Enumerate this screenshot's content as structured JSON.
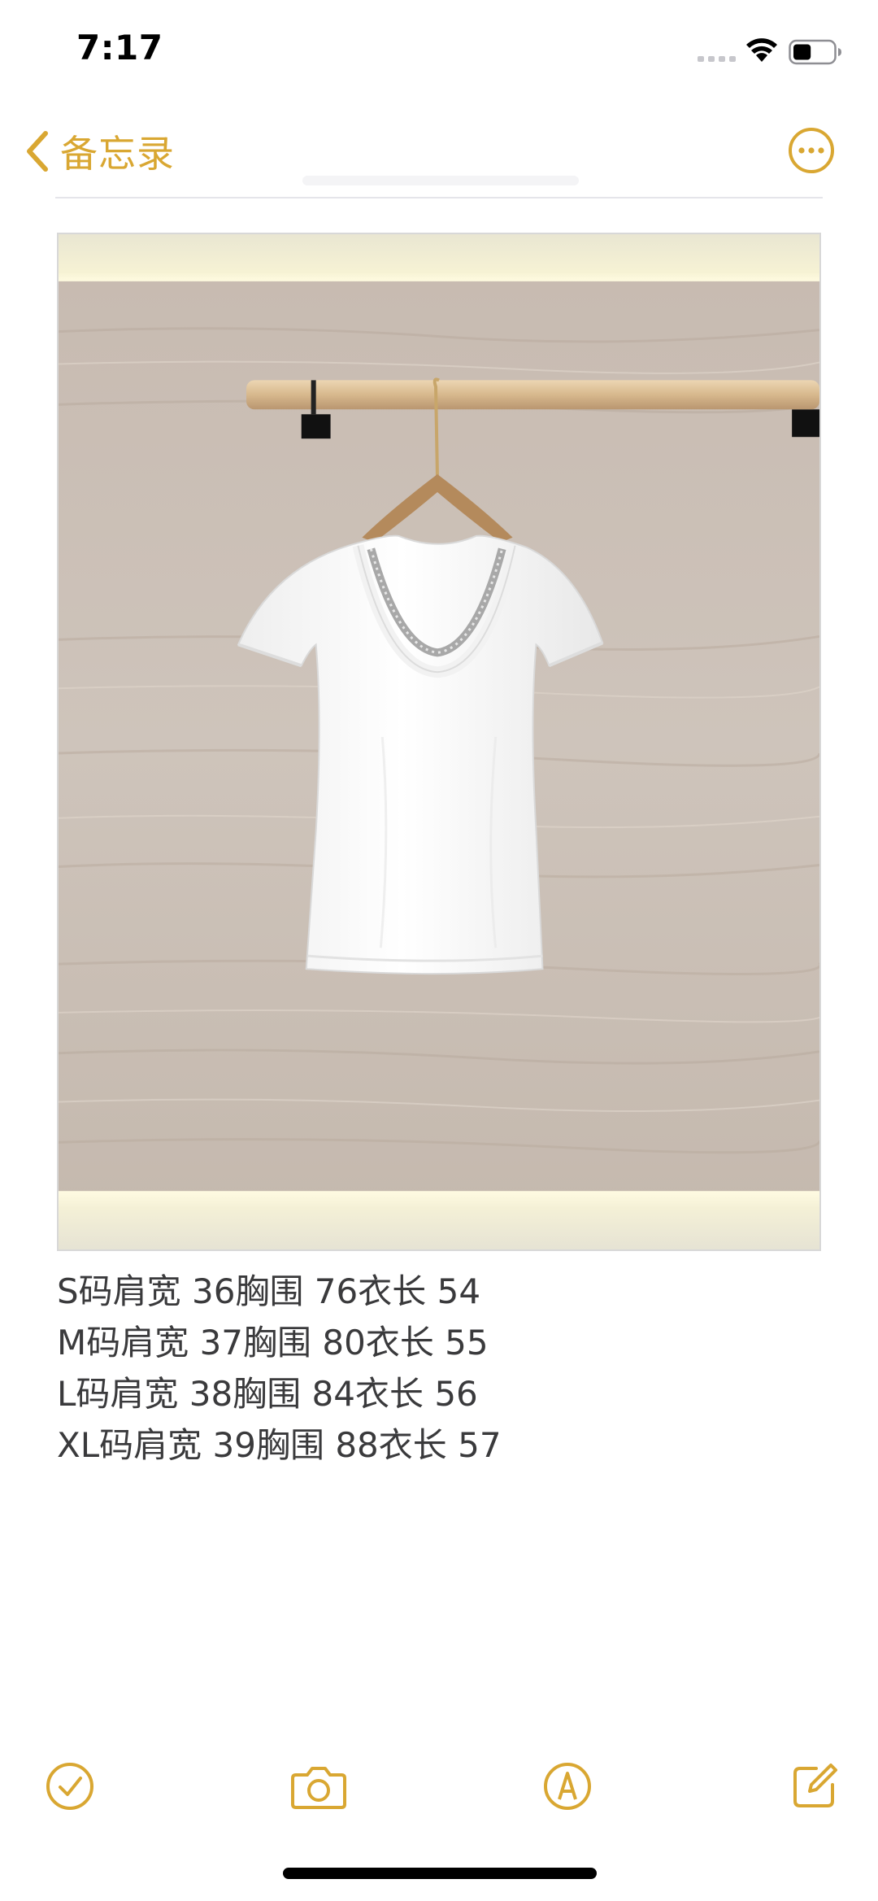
{
  "status_bar": {
    "time": "7:17",
    "battery_level": 0.45
  },
  "nav": {
    "back_label": "备忘录",
    "back_icon": "chevron-left-icon",
    "more_icon": "ellipsis-circle-icon"
  },
  "note": {
    "image_description_icon": "photo",
    "lines": [
      "S码肩宽 36胸围 76衣长 54",
      "M码肩宽 37胸围 80衣长 55",
      "L码肩宽 38胸围 84衣长 56",
      "XL码肩宽 39胸围 88衣长 57"
    ]
  },
  "toolbar": {
    "items": [
      {
        "icon": "checklist-icon"
      },
      {
        "icon": "camera-icon"
      },
      {
        "icon": "markup-pen-icon"
      },
      {
        "icon": "compose-icon"
      }
    ]
  },
  "colors": {
    "accent": "#d9a732",
    "text": "#3a3a3c",
    "divider": "#e5e5ea"
  }
}
